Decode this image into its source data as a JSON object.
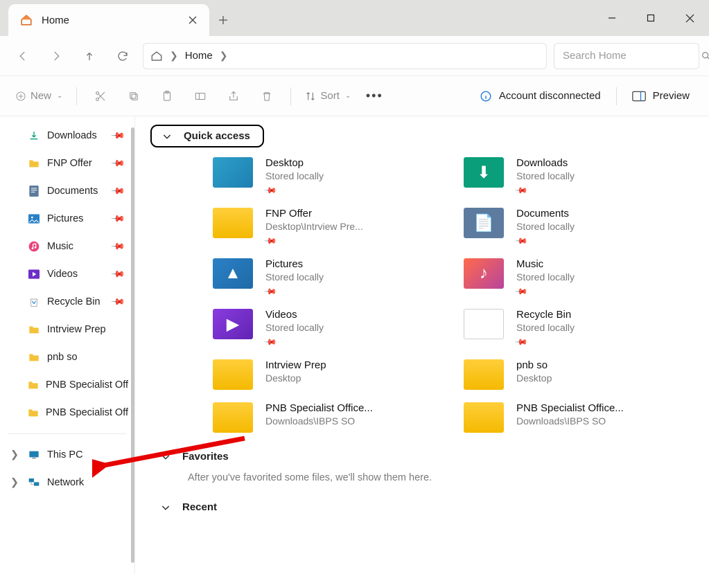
{
  "window": {
    "tab_label": "Home",
    "search_placeholder": "Search Home"
  },
  "breadcrumb": {
    "segment": "Home"
  },
  "cmdbar": {
    "new": "New",
    "sort": "Sort",
    "account": "Account disconnected",
    "preview": "Preview"
  },
  "sidebar": {
    "items": [
      {
        "icon": "downloads",
        "label": "Downloads",
        "pinned": true
      },
      {
        "icon": "folder",
        "label": "FNP Offer",
        "pinned": true
      },
      {
        "icon": "docs",
        "label": "Documents",
        "pinned": true
      },
      {
        "icon": "pics",
        "label": "Pictures",
        "pinned": true
      },
      {
        "icon": "music",
        "label": "Music",
        "pinned": true
      },
      {
        "icon": "video",
        "label": "Videos",
        "pinned": true
      },
      {
        "icon": "recycle",
        "label": "Recycle Bin",
        "pinned": true
      },
      {
        "icon": "folder",
        "label": "Intrview Prep",
        "pinned": false
      },
      {
        "icon": "folder",
        "label": "pnb so",
        "pinned": false
      },
      {
        "icon": "folder",
        "label": "PNB Specialist Off",
        "pinned": false
      },
      {
        "icon": "folder",
        "label": "PNB Specialist Off",
        "pinned": false
      }
    ],
    "tree": [
      {
        "icon": "pc",
        "label": "This PC"
      },
      {
        "icon": "net",
        "label": "Network"
      }
    ]
  },
  "main": {
    "quick_access": "Quick access",
    "favorites": "Favorites",
    "fav_empty": "After you've favorited some files, we'll show them here.",
    "recent": "Recent",
    "qa": [
      {
        "thumb": "desktop",
        "title": "Desktop",
        "sub": "Stored locally",
        "pin": true
      },
      {
        "thumb": "downloads",
        "title": "Downloads",
        "sub": "Stored locally",
        "pin": true
      },
      {
        "thumb": "folder",
        "title": "FNP Offer",
        "sub": "Desktop\\Intrview Pre...",
        "pin": true
      },
      {
        "thumb": "docs",
        "title": "Documents",
        "sub": "Stored locally",
        "pin": true
      },
      {
        "thumb": "pics",
        "title": "Pictures",
        "sub": "Stored locally",
        "pin": true
      },
      {
        "thumb": "music",
        "title": "Music",
        "sub": "Stored locally",
        "pin": true
      },
      {
        "thumb": "video",
        "title": "Videos",
        "sub": "Stored locally",
        "pin": true
      },
      {
        "thumb": "recycle",
        "title": "Recycle Bin",
        "sub": "Stored locally",
        "pin": true
      },
      {
        "thumb": "folder",
        "title": "Intrview Prep",
        "sub": "Desktop",
        "pin": false
      },
      {
        "thumb": "folder",
        "title": "pnb so",
        "sub": "Desktop",
        "pin": false
      },
      {
        "thumb": "folder",
        "title": "PNB Specialist Office...",
        "sub": "Downloads\\IBPS SO",
        "pin": false
      },
      {
        "thumb": "folder",
        "title": "PNB Specialist Office...",
        "sub": "Downloads\\IBPS SO",
        "pin": false
      }
    ]
  }
}
